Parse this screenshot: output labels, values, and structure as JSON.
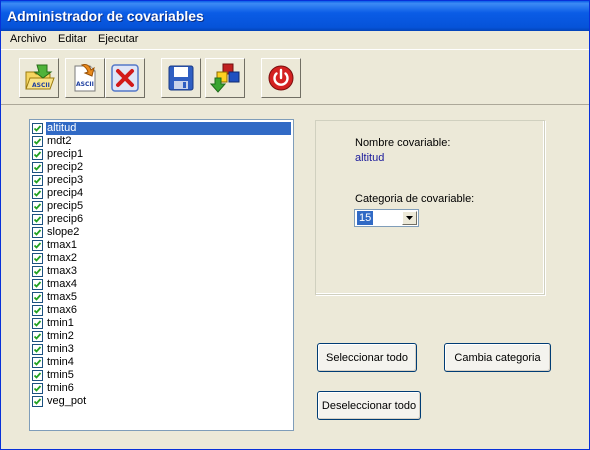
{
  "window": {
    "title": "Administrador de covariables"
  },
  "menu": [
    "Archivo",
    "Editar",
    "Ejecutar"
  ],
  "toolbar": {
    "buttons": [
      {
        "name": "open-ascii-icon",
        "label": "ASCII"
      },
      {
        "name": "export-ascii-icon",
        "label": "ASCII"
      },
      {
        "name": "delete-icon",
        "label": ""
      },
      {
        "name": "save-icon",
        "label": ""
      },
      {
        "name": "process-icon",
        "label": ""
      },
      {
        "name": "power-icon",
        "label": ""
      }
    ]
  },
  "covariables": [
    {
      "label": "altitud",
      "checked": true,
      "selected": true
    },
    {
      "label": "mdt2",
      "checked": true
    },
    {
      "label": "precip1",
      "checked": true
    },
    {
      "label": "precip2",
      "checked": true
    },
    {
      "label": "precip3",
      "checked": true
    },
    {
      "label": "precip4",
      "checked": true
    },
    {
      "label": "precip5",
      "checked": true
    },
    {
      "label": "precip6",
      "checked": true
    },
    {
      "label": "slope2",
      "checked": true
    },
    {
      "label": "tmax1",
      "checked": true
    },
    {
      "label": "tmax2",
      "checked": true
    },
    {
      "label": "tmax3",
      "checked": true
    },
    {
      "label": "tmax4",
      "checked": true
    },
    {
      "label": "tmax5",
      "checked": true
    },
    {
      "label": "tmax6",
      "checked": true
    },
    {
      "label": "tmin1",
      "checked": true
    },
    {
      "label": "tmin2",
      "checked": true
    },
    {
      "label": "tmin3",
      "checked": true
    },
    {
      "label": "tmin4",
      "checked": true
    },
    {
      "label": "tmin5",
      "checked": true
    },
    {
      "label": "tmin6",
      "checked": true
    },
    {
      "label": "veg_pot",
      "checked": true
    }
  ],
  "details": {
    "name_label": "Nombre covariable:",
    "name_value": "altitud",
    "category_label": "Categoria de covariable:",
    "category_value": "15"
  },
  "buttons": {
    "select_all": "Seleccionar todo",
    "change_category": "Cambia categoria",
    "deselect_all": "Deseleccionar todo"
  },
  "colors": {
    "titlebar": "#0a5ce6",
    "selection": "#316ac5",
    "value_text": "#1a1a9c"
  }
}
